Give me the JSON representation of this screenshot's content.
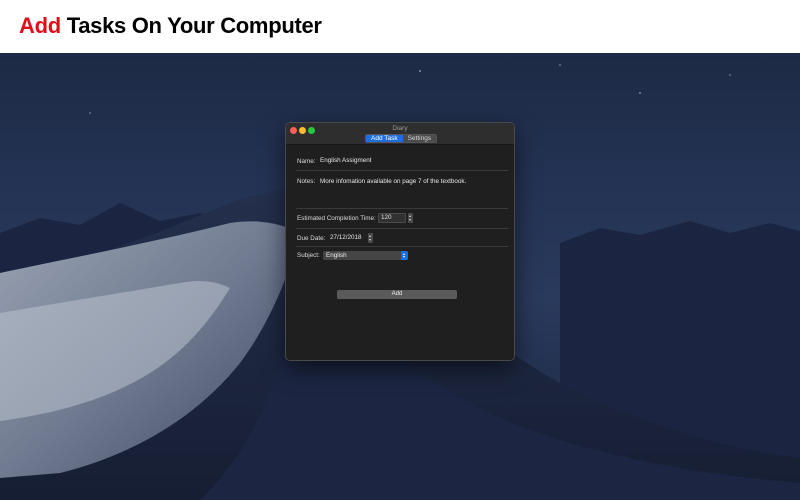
{
  "banner": {
    "accent_word": "Add",
    "rest": "Tasks On Your Computer",
    "accent_color": "#e0101a"
  },
  "window": {
    "title": "Diary",
    "tabs": [
      {
        "label": "Add Task",
        "active": true
      },
      {
        "label": "Settings",
        "active": false
      }
    ]
  },
  "form": {
    "name_label": "Name:",
    "name_value": "English Assigment",
    "notes_label": "Notes:",
    "notes_value": "More infomation available on page 7 of the textbook.",
    "est_label": "Estimated Completion Time:",
    "est_value": "120",
    "due_label": "Due Date:",
    "due_value": "27/12/2018",
    "subject_label": "Subject:",
    "subject_value": "English",
    "add_label": "Add"
  },
  "colors": {
    "accent_blue": "#1d6ee0",
    "window_bg": "#1f1f1f"
  }
}
